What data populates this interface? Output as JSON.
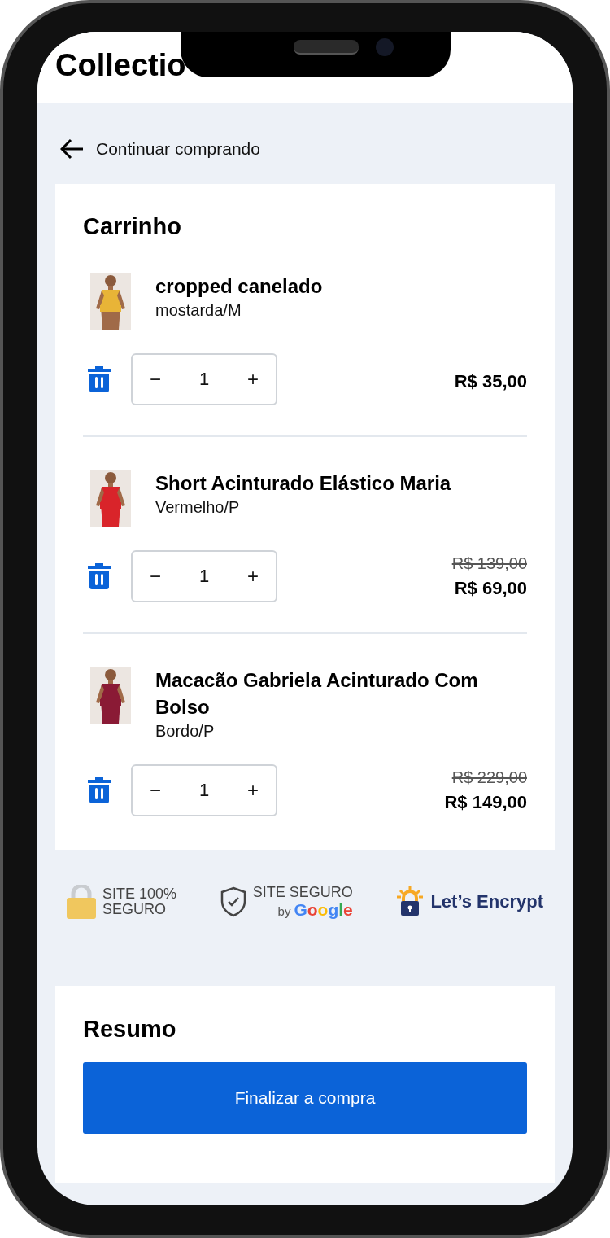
{
  "header": {
    "title": "Collectio"
  },
  "back_link": {
    "label": "Continuar comprando"
  },
  "cart": {
    "title": "Carrinho",
    "items": [
      {
        "name": "cropped canelado",
        "variant": "mostarda/M",
        "decrement": "−",
        "quantity": "1",
        "increment": "+",
        "price": "R$ 35,00"
      },
      {
        "name": "Short Acinturado Elástico Maria",
        "variant": "Vermelho/P",
        "decrement": "−",
        "quantity": "1",
        "increment": "+",
        "old_price": "R$ 139,00",
        "price": "R$ 69,00"
      },
      {
        "name": "Macacão Gabriela Acinturado Com Bolso",
        "variant": "Bordo/P",
        "decrement": "−",
        "quantity": "1",
        "increment": "+",
        "old_price": "R$ 229,00",
        "price": "R$ 149,00"
      }
    ]
  },
  "badges": [
    {
      "kind": "padlock",
      "lines": [
        "SITE 100%",
        "SEGURO"
      ]
    },
    {
      "kind": "shield",
      "lines": [
        "SITE SEGURO"
      ],
      "by": "by",
      "brand": "Google"
    },
    {
      "kind": "encrypt",
      "brand": "Let’s Encrypt"
    }
  ],
  "summary": {
    "title": "Resumo",
    "button": "Finalizar a compra"
  }
}
